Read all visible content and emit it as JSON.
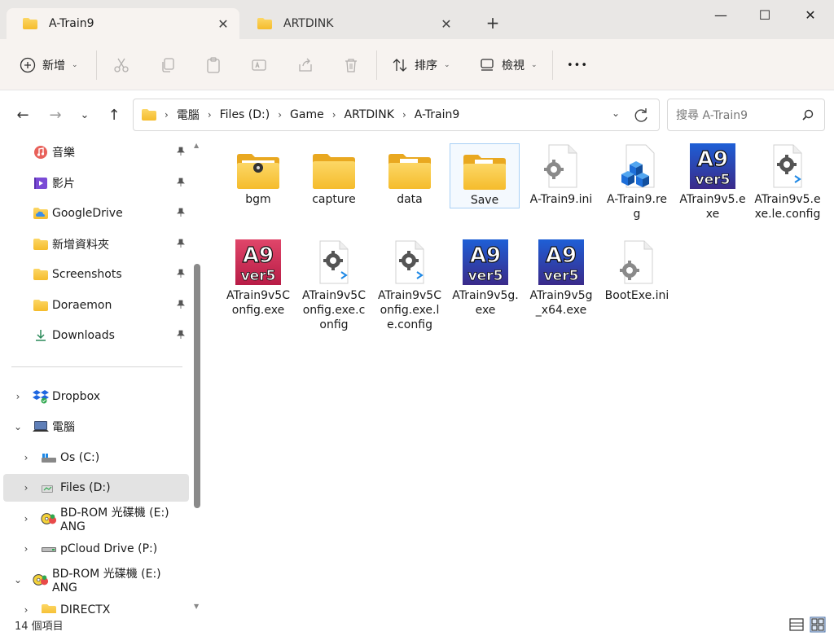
{
  "window": {
    "tabs": [
      {
        "label": "A-Train9",
        "active": true
      },
      {
        "label": "ARTDINK",
        "active": false
      }
    ],
    "new_tab_label": "+",
    "controls": {
      "minimize": "—",
      "maximize": "☐",
      "close": "✕"
    }
  },
  "toolbar": {
    "new_label": "新增",
    "sort_label": "排序",
    "view_label": "檢視",
    "more_label": "•••",
    "icons": [
      "cut-icon",
      "copy-icon",
      "paste-icon",
      "rename-icon",
      "share-icon",
      "delete-icon"
    ]
  },
  "address": {
    "breadcrumbs": [
      "電腦",
      "Files (D:)",
      "Game",
      "ARTDINK",
      "A-Train9"
    ],
    "search_placeholder": "搜尋 A-Train9"
  },
  "sidebar": {
    "quick_access": [
      {
        "label": "音樂",
        "icon": "music-icon",
        "pinned": true
      },
      {
        "label": "影片",
        "icon": "video-icon",
        "pinned": true
      },
      {
        "label": "GoogleDrive",
        "icon": "cloud-folder-icon",
        "pinned": true
      },
      {
        "label": "新增資料夾",
        "icon": "folder-icon",
        "pinned": true
      },
      {
        "label": "Screenshots",
        "icon": "folder-icon",
        "pinned": true
      },
      {
        "label": "Doraemon",
        "icon": "folder-icon",
        "pinned": true
      },
      {
        "label": "Downloads",
        "icon": "download-icon",
        "pinned": true
      }
    ],
    "tree": [
      {
        "label": "Dropbox",
        "icon": "dropbox-icon",
        "expander": "›",
        "level": 0
      },
      {
        "label": "電腦",
        "icon": "computer-icon",
        "expander": "⌄",
        "level": 0
      },
      {
        "label": "Os (C:)",
        "icon": "windows-drive-icon",
        "expander": "›",
        "level": 1
      },
      {
        "label": "Files (D:)",
        "icon": "drive-icon",
        "expander": "›",
        "level": 1,
        "selected": true
      },
      {
        "label": "BD-ROM 光碟機 (E:) ANG",
        "icon": "disc-icon",
        "expander": "›",
        "level": 1
      },
      {
        "label": "pCloud Drive (P:)",
        "icon": "network-drive-icon",
        "expander": "›",
        "level": 1
      },
      {
        "label": "BD-ROM 光碟機 (E:) ANG",
        "icon": "disc-icon",
        "expander": "⌄",
        "level": 0
      },
      {
        "label": "DIRECTX",
        "icon": "folder-icon",
        "expander": "›",
        "level": 1
      }
    ]
  },
  "files": [
    {
      "name": "bgm",
      "icon": "folder-with-audio-icon"
    },
    {
      "name": "capture",
      "icon": "folder-icon"
    },
    {
      "name": "data",
      "icon": "folder-with-doc-icon"
    },
    {
      "name": "Save",
      "icon": "folder-with-doc-icon",
      "selected": true
    },
    {
      "name": "A-Train9.ini",
      "icon": "settings-file-icon"
    },
    {
      "name": "A-Train9.reg",
      "icon": "registry-file-icon"
    },
    {
      "name": "ATrain9v5.exe",
      "icon": "a9-ver5-blue-icon"
    },
    {
      "name": "ATrain9v5.exe.le.config",
      "icon": "config-file-icon"
    },
    {
      "name": "ATrain9v5Config.exe",
      "icon": "a9-ver5-red-icon"
    },
    {
      "name": "ATrain9v5Config.exe.config",
      "icon": "config-file-icon"
    },
    {
      "name": "ATrain9v5Config.exe.le.config",
      "icon": "config-file-icon"
    },
    {
      "name": "ATrain9v5g.exe",
      "icon": "a9-ver5-blue-icon"
    },
    {
      "name": "ATrain9v5g_x64.exe",
      "icon": "a9-ver5-blue-icon"
    },
    {
      "name": "BootExe.ini",
      "icon": "settings-file-icon"
    }
  ],
  "status": {
    "item_count": "14 個項目"
  },
  "colors": {
    "folder_yellow": "#f8c740",
    "folder_dark": "#e9a820",
    "selection_border": "#a8d0f5",
    "a9_blue": "#2a3d9e",
    "a9_red": "#c2284a"
  }
}
